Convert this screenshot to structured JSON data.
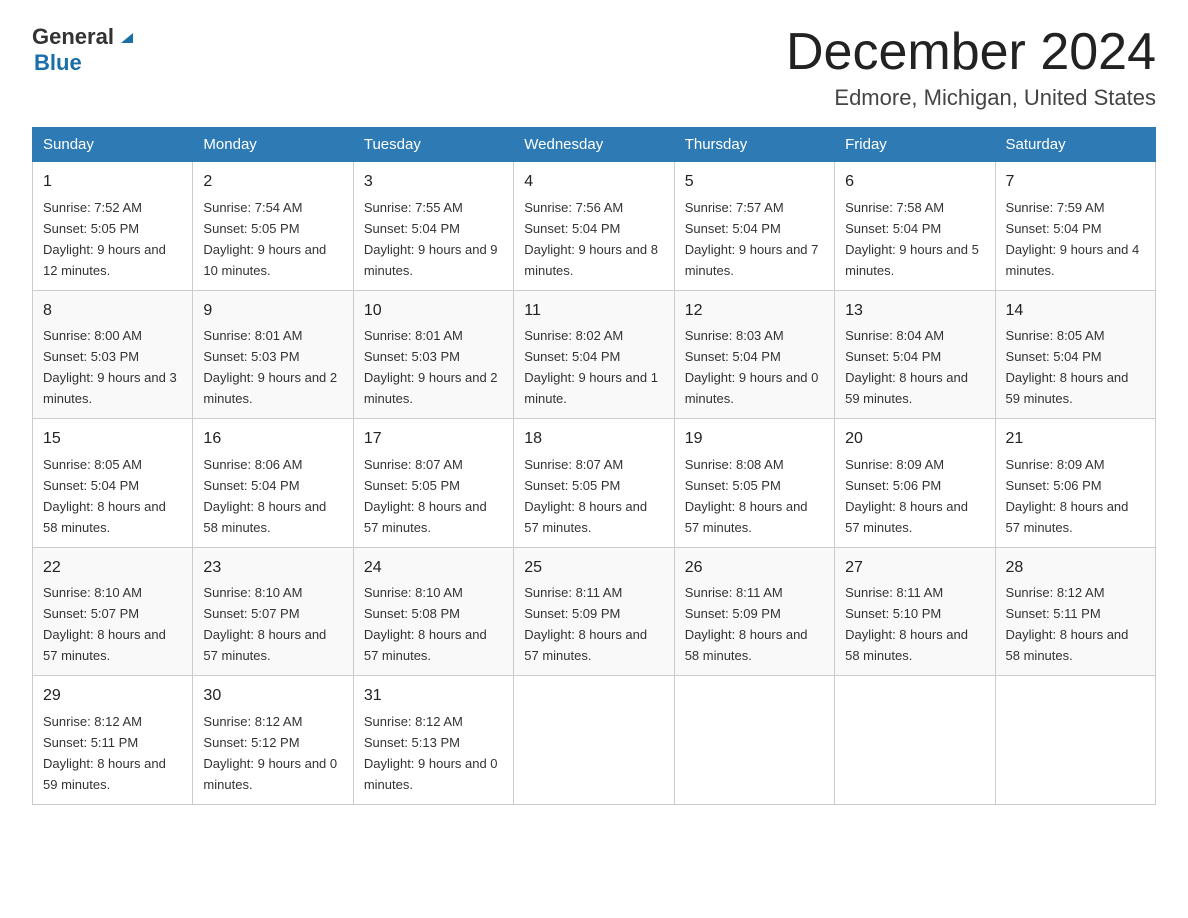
{
  "header": {
    "logo_general": "General",
    "logo_blue": "Blue",
    "month_title": "December 2024",
    "location": "Edmore, Michigan, United States"
  },
  "days_of_week": [
    "Sunday",
    "Monday",
    "Tuesday",
    "Wednesday",
    "Thursday",
    "Friday",
    "Saturday"
  ],
  "weeks": [
    [
      {
        "day": "1",
        "sunrise": "Sunrise: 7:52 AM",
        "sunset": "Sunset: 5:05 PM",
        "daylight": "Daylight: 9 hours and 12 minutes."
      },
      {
        "day": "2",
        "sunrise": "Sunrise: 7:54 AM",
        "sunset": "Sunset: 5:05 PM",
        "daylight": "Daylight: 9 hours and 10 minutes."
      },
      {
        "day": "3",
        "sunrise": "Sunrise: 7:55 AM",
        "sunset": "Sunset: 5:04 PM",
        "daylight": "Daylight: 9 hours and 9 minutes."
      },
      {
        "day": "4",
        "sunrise": "Sunrise: 7:56 AM",
        "sunset": "Sunset: 5:04 PM",
        "daylight": "Daylight: 9 hours and 8 minutes."
      },
      {
        "day": "5",
        "sunrise": "Sunrise: 7:57 AM",
        "sunset": "Sunset: 5:04 PM",
        "daylight": "Daylight: 9 hours and 7 minutes."
      },
      {
        "day": "6",
        "sunrise": "Sunrise: 7:58 AM",
        "sunset": "Sunset: 5:04 PM",
        "daylight": "Daylight: 9 hours and 5 minutes."
      },
      {
        "day": "7",
        "sunrise": "Sunrise: 7:59 AM",
        "sunset": "Sunset: 5:04 PM",
        "daylight": "Daylight: 9 hours and 4 minutes."
      }
    ],
    [
      {
        "day": "8",
        "sunrise": "Sunrise: 8:00 AM",
        "sunset": "Sunset: 5:03 PM",
        "daylight": "Daylight: 9 hours and 3 minutes."
      },
      {
        "day": "9",
        "sunrise": "Sunrise: 8:01 AM",
        "sunset": "Sunset: 5:03 PM",
        "daylight": "Daylight: 9 hours and 2 minutes."
      },
      {
        "day": "10",
        "sunrise": "Sunrise: 8:01 AM",
        "sunset": "Sunset: 5:03 PM",
        "daylight": "Daylight: 9 hours and 2 minutes."
      },
      {
        "day": "11",
        "sunrise": "Sunrise: 8:02 AM",
        "sunset": "Sunset: 5:04 PM",
        "daylight": "Daylight: 9 hours and 1 minute."
      },
      {
        "day": "12",
        "sunrise": "Sunrise: 8:03 AM",
        "sunset": "Sunset: 5:04 PM",
        "daylight": "Daylight: 9 hours and 0 minutes."
      },
      {
        "day": "13",
        "sunrise": "Sunrise: 8:04 AM",
        "sunset": "Sunset: 5:04 PM",
        "daylight": "Daylight: 8 hours and 59 minutes."
      },
      {
        "day": "14",
        "sunrise": "Sunrise: 8:05 AM",
        "sunset": "Sunset: 5:04 PM",
        "daylight": "Daylight: 8 hours and 59 minutes."
      }
    ],
    [
      {
        "day": "15",
        "sunrise": "Sunrise: 8:05 AM",
        "sunset": "Sunset: 5:04 PM",
        "daylight": "Daylight: 8 hours and 58 minutes."
      },
      {
        "day": "16",
        "sunrise": "Sunrise: 8:06 AM",
        "sunset": "Sunset: 5:04 PM",
        "daylight": "Daylight: 8 hours and 58 minutes."
      },
      {
        "day": "17",
        "sunrise": "Sunrise: 8:07 AM",
        "sunset": "Sunset: 5:05 PM",
        "daylight": "Daylight: 8 hours and 57 minutes."
      },
      {
        "day": "18",
        "sunrise": "Sunrise: 8:07 AM",
        "sunset": "Sunset: 5:05 PM",
        "daylight": "Daylight: 8 hours and 57 minutes."
      },
      {
        "day": "19",
        "sunrise": "Sunrise: 8:08 AM",
        "sunset": "Sunset: 5:05 PM",
        "daylight": "Daylight: 8 hours and 57 minutes."
      },
      {
        "day": "20",
        "sunrise": "Sunrise: 8:09 AM",
        "sunset": "Sunset: 5:06 PM",
        "daylight": "Daylight: 8 hours and 57 minutes."
      },
      {
        "day": "21",
        "sunrise": "Sunrise: 8:09 AM",
        "sunset": "Sunset: 5:06 PM",
        "daylight": "Daylight: 8 hours and 57 minutes."
      }
    ],
    [
      {
        "day": "22",
        "sunrise": "Sunrise: 8:10 AM",
        "sunset": "Sunset: 5:07 PM",
        "daylight": "Daylight: 8 hours and 57 minutes."
      },
      {
        "day": "23",
        "sunrise": "Sunrise: 8:10 AM",
        "sunset": "Sunset: 5:07 PM",
        "daylight": "Daylight: 8 hours and 57 minutes."
      },
      {
        "day": "24",
        "sunrise": "Sunrise: 8:10 AM",
        "sunset": "Sunset: 5:08 PM",
        "daylight": "Daylight: 8 hours and 57 minutes."
      },
      {
        "day": "25",
        "sunrise": "Sunrise: 8:11 AM",
        "sunset": "Sunset: 5:09 PM",
        "daylight": "Daylight: 8 hours and 57 minutes."
      },
      {
        "day": "26",
        "sunrise": "Sunrise: 8:11 AM",
        "sunset": "Sunset: 5:09 PM",
        "daylight": "Daylight: 8 hours and 58 minutes."
      },
      {
        "day": "27",
        "sunrise": "Sunrise: 8:11 AM",
        "sunset": "Sunset: 5:10 PM",
        "daylight": "Daylight: 8 hours and 58 minutes."
      },
      {
        "day": "28",
        "sunrise": "Sunrise: 8:12 AM",
        "sunset": "Sunset: 5:11 PM",
        "daylight": "Daylight: 8 hours and 58 minutes."
      }
    ],
    [
      {
        "day": "29",
        "sunrise": "Sunrise: 8:12 AM",
        "sunset": "Sunset: 5:11 PM",
        "daylight": "Daylight: 8 hours and 59 minutes."
      },
      {
        "day": "30",
        "sunrise": "Sunrise: 8:12 AM",
        "sunset": "Sunset: 5:12 PM",
        "daylight": "Daylight: 9 hours and 0 minutes."
      },
      {
        "day": "31",
        "sunrise": "Sunrise: 8:12 AM",
        "sunset": "Sunset: 5:13 PM",
        "daylight": "Daylight: 9 hours and 0 minutes."
      },
      null,
      null,
      null,
      null
    ]
  ]
}
